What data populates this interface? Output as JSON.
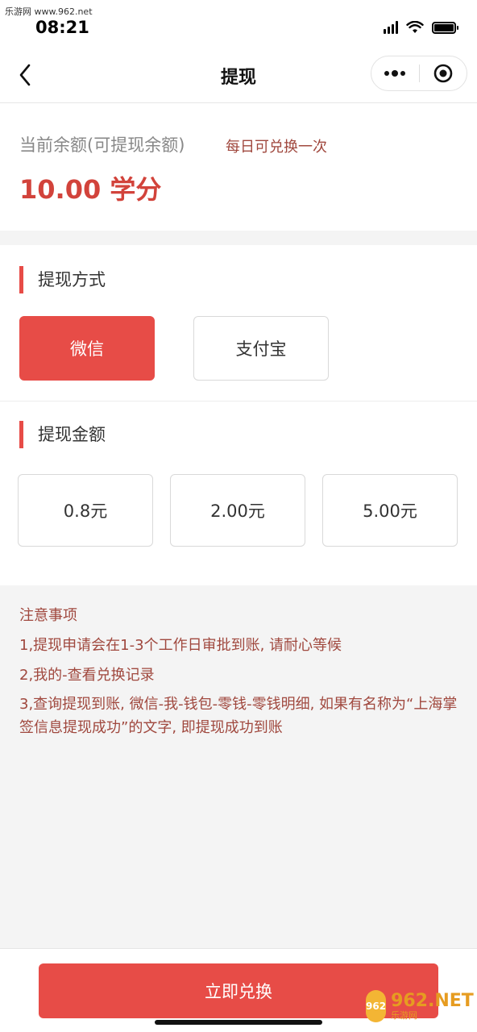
{
  "status_bar": {
    "watermark": "乐游网 www.962.net",
    "time": "08:21"
  },
  "nav": {
    "title": "提现"
  },
  "balance": {
    "label": "当前余额(可提现余额)",
    "note": "每日可兑换一次",
    "amount": "10.00 学分"
  },
  "method": {
    "title": "提现方式",
    "options": [
      {
        "label": "微信",
        "selected": true
      },
      {
        "label": "支付宝",
        "selected": false
      }
    ]
  },
  "amount": {
    "title": "提现金额",
    "options": [
      {
        "label": "0.8元"
      },
      {
        "label": "2.00元"
      },
      {
        "label": "5.00元"
      }
    ]
  },
  "notes": {
    "heading": "注意事项",
    "items": [
      "1,提现申请会在1-3个工作日审批到账, 请耐心等候",
      "2,我的-查看兑换记录",
      "3,查询提现到账, 微信-我-钱包-零钱-零钱明细, 如果有名称为“上海掌签信息提现成功”的文字, 即提现成功到账"
    ]
  },
  "submit": {
    "label": "立即兑换"
  },
  "watermark_badge": {
    "big": "962.NET",
    "small": "乐游网"
  },
  "colors": {
    "accent": "#e74c47",
    "note_text": "#a0483e",
    "amount_text": "#d2433b"
  }
}
